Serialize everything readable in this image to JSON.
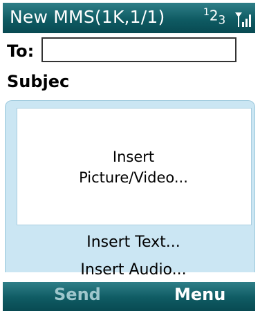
{
  "title_bar": {
    "title": "New MMS(1K,1/1)",
    "input_mode_base": "2",
    "input_mode_sup1": "1",
    "input_mode_sub3": "3"
  },
  "compose": {
    "to_label": "To:",
    "to_value": "",
    "subject_label": "Subjec"
  },
  "menu": {
    "insert_picture_line1": "Insert",
    "insert_picture_line2": "Picture/Video...",
    "insert_text": "Insert Text...",
    "insert_audio": "Insert Audio..."
  },
  "softkeys": {
    "left": "Send",
    "right": "Menu"
  },
  "colors": {
    "bar": "#0f5b63",
    "panel": "#cbe6f3",
    "softkey_disabled": "#9ec6cc"
  }
}
